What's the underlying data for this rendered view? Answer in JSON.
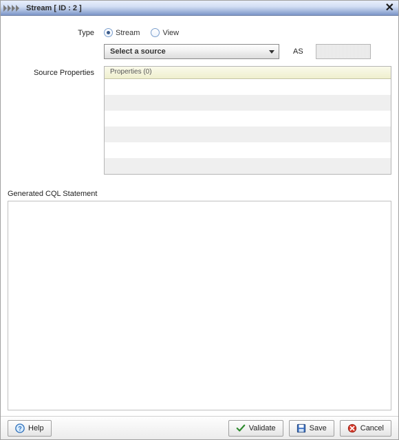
{
  "window": {
    "title": "Stream [ ID : 2 ]"
  },
  "form": {
    "type_label": "Type",
    "radio_stream": "Stream",
    "radio_view": "View",
    "radio_selected": "stream",
    "source_select": "Select a source",
    "as_label": "AS",
    "as_value": "",
    "source_props_label": "Source Properties",
    "props_header": "Properties (0)"
  },
  "cql": {
    "label": "Generated CQL Statement"
  },
  "buttons": {
    "help": "Help",
    "validate": "Validate",
    "save": "Save",
    "cancel": "Cancel"
  }
}
